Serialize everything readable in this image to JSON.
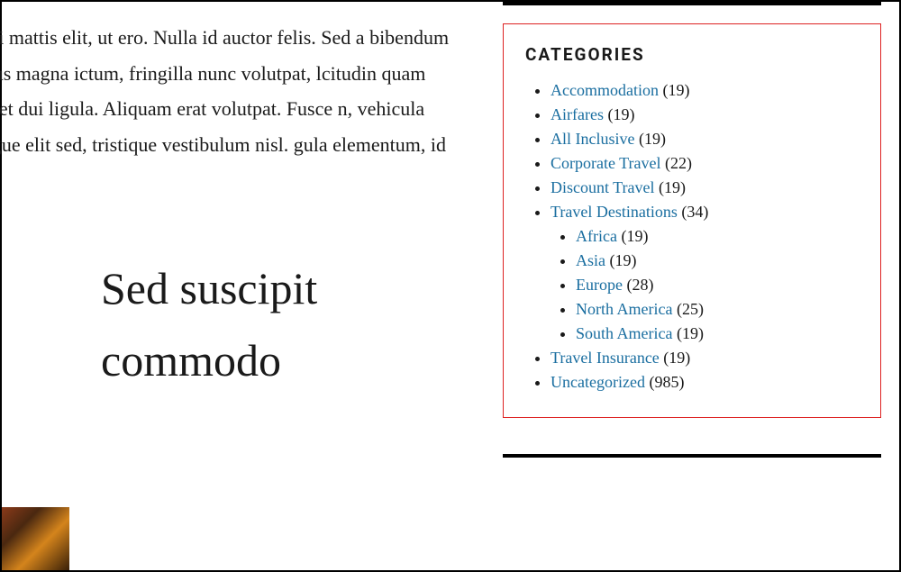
{
  "article": {
    "body_text": "orper maximus, velit orci mattis elit, ut ero. Nulla id auctor felis. Sed a bibendum blandit ante erat, et cursus magna ictum, fringilla nunc volutpat, lcitudin quam quis sem placerat, sit amet dui ligula. Aliquam erat volutpat. Fusce n, vehicula malesuada erat. Cras augue elit sed, tristique vestibulum nisl. gula elementum, id cursus nisi efficitury.",
    "heading": "Sed suscipit commodo"
  },
  "sidebar": {
    "widget_title": "CATEGORIES",
    "categories": [
      {
        "label": "Accommodation",
        "count": "(19)"
      },
      {
        "label": "Airfares",
        "count": "(19)"
      },
      {
        "label": "All Inclusive",
        "count": "(19)"
      },
      {
        "label": "Corporate Travel",
        "count": "(22)"
      },
      {
        "label": "Discount Travel",
        "count": "(19)"
      },
      {
        "label": "Travel Destinations",
        "count": "(34)",
        "children": [
          {
            "label": "Africa",
            "count": "(19)"
          },
          {
            "label": "Asia",
            "count": "(19)"
          },
          {
            "label": "Europe",
            "count": "(28)"
          },
          {
            "label": "North America",
            "count": "(25)"
          },
          {
            "label": "South America",
            "count": "(19)"
          }
        ]
      },
      {
        "label": "Travel Insurance",
        "count": "(19)"
      },
      {
        "label": "Uncategorized",
        "count": "(985)"
      }
    ]
  }
}
